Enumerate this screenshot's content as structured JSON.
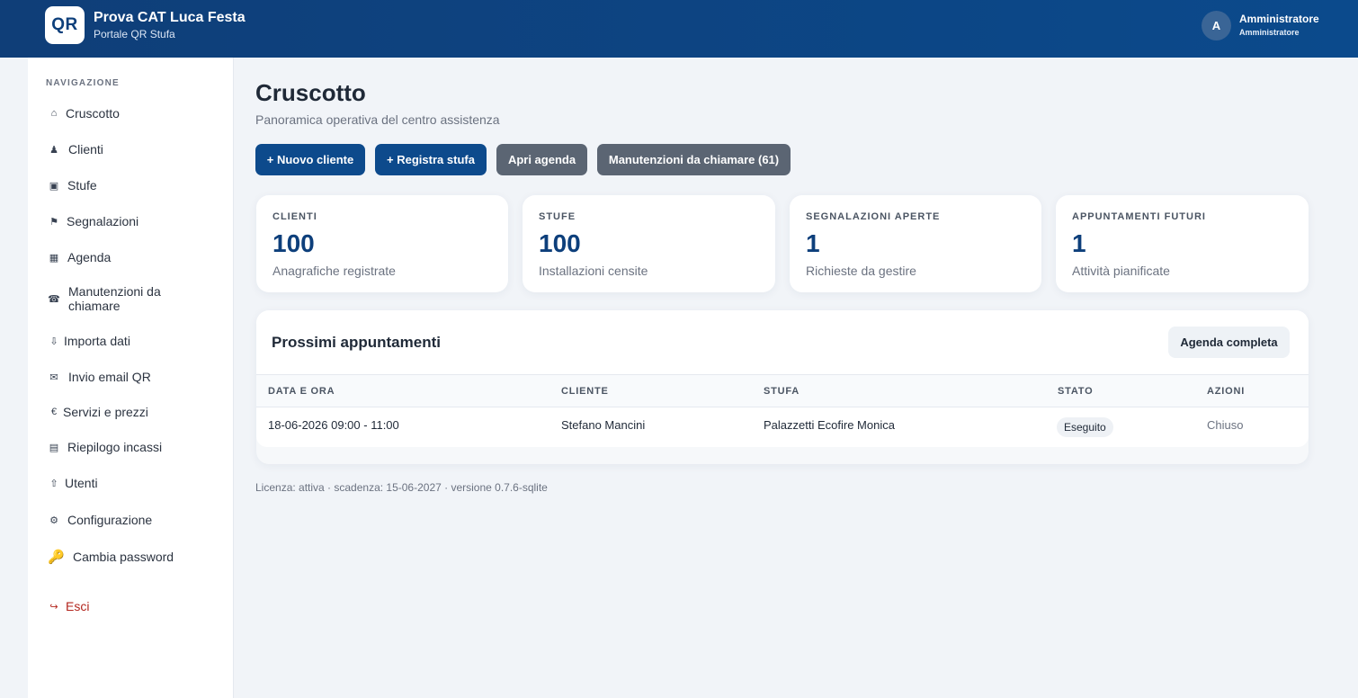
{
  "header": {
    "logo": "QR",
    "title": "Prova CAT Luca Festa",
    "subtitle": "Portale QR Stufa",
    "avatar_initial": "A",
    "user_name": "Amministratore",
    "user_role": "Amministratore"
  },
  "sidebar": {
    "heading": "NAVIGAZIONE",
    "items": [
      {
        "icon": "⌂",
        "label": "Cruscotto"
      },
      {
        "icon": "♟",
        "label": "Clienti"
      },
      {
        "icon": "▣",
        "label": "Stufe"
      },
      {
        "icon": "⚑",
        "label": "Segnalazioni"
      },
      {
        "icon": "▦",
        "label": "Agenda"
      },
      {
        "icon": "☎",
        "label": "Manutenzioni da chiamare"
      },
      {
        "icon": "⇩",
        "label": "Importa dati"
      },
      {
        "icon": "✉",
        "label": "Invio email QR"
      },
      {
        "icon": "€",
        "label": "Servizi e prezzi"
      },
      {
        "icon": "▤",
        "label": "Riepilogo incassi"
      },
      {
        "icon": "⇧",
        "label": "Utenti"
      },
      {
        "icon": "⚙",
        "label": "Configurazione"
      },
      {
        "icon": "🔑",
        "label": "Cambia password"
      }
    ],
    "exit": {
      "icon": "↪",
      "label": "Esci"
    }
  },
  "page": {
    "title": "Cruscotto",
    "subtitle": "Panoramica operativa del centro assistenza"
  },
  "actions": {
    "new_client": "+ Nuovo cliente",
    "register_stove": "+ Registra stufa",
    "open_agenda": "Apri agenda",
    "maintenance_calls": "Manutenzioni da chiamare (61)"
  },
  "stats": [
    {
      "label": "CLIENTI",
      "value": "100",
      "desc": "Anagrafiche registrate"
    },
    {
      "label": "STUFE",
      "value": "100",
      "desc": "Installazioni censite"
    },
    {
      "label": "SEGNALAZIONI APERTE",
      "value": "1",
      "desc": "Richieste da gestire"
    },
    {
      "label": "APPUNTAMENTI FUTURI",
      "value": "1",
      "desc": "Attività pianificate"
    }
  ],
  "appointments": {
    "title": "Prossimi appuntamenti",
    "full_agenda": "Agenda completa",
    "columns": [
      "DATA E ORA",
      "CLIENTE",
      "STUFA",
      "STATO",
      "AZIONI"
    ],
    "rows": [
      {
        "datetime": "18-06-2026 09:00 - 11:00",
        "client": "Stefano Mancini",
        "stove": "Palazzetti Ecofire Monica",
        "status": "Eseguito",
        "action": "Chiuso"
      }
    ]
  },
  "footer": "Licenza: attiva · scadenza: 15-06-2027 · versione 0.7.6-sqlite"
}
